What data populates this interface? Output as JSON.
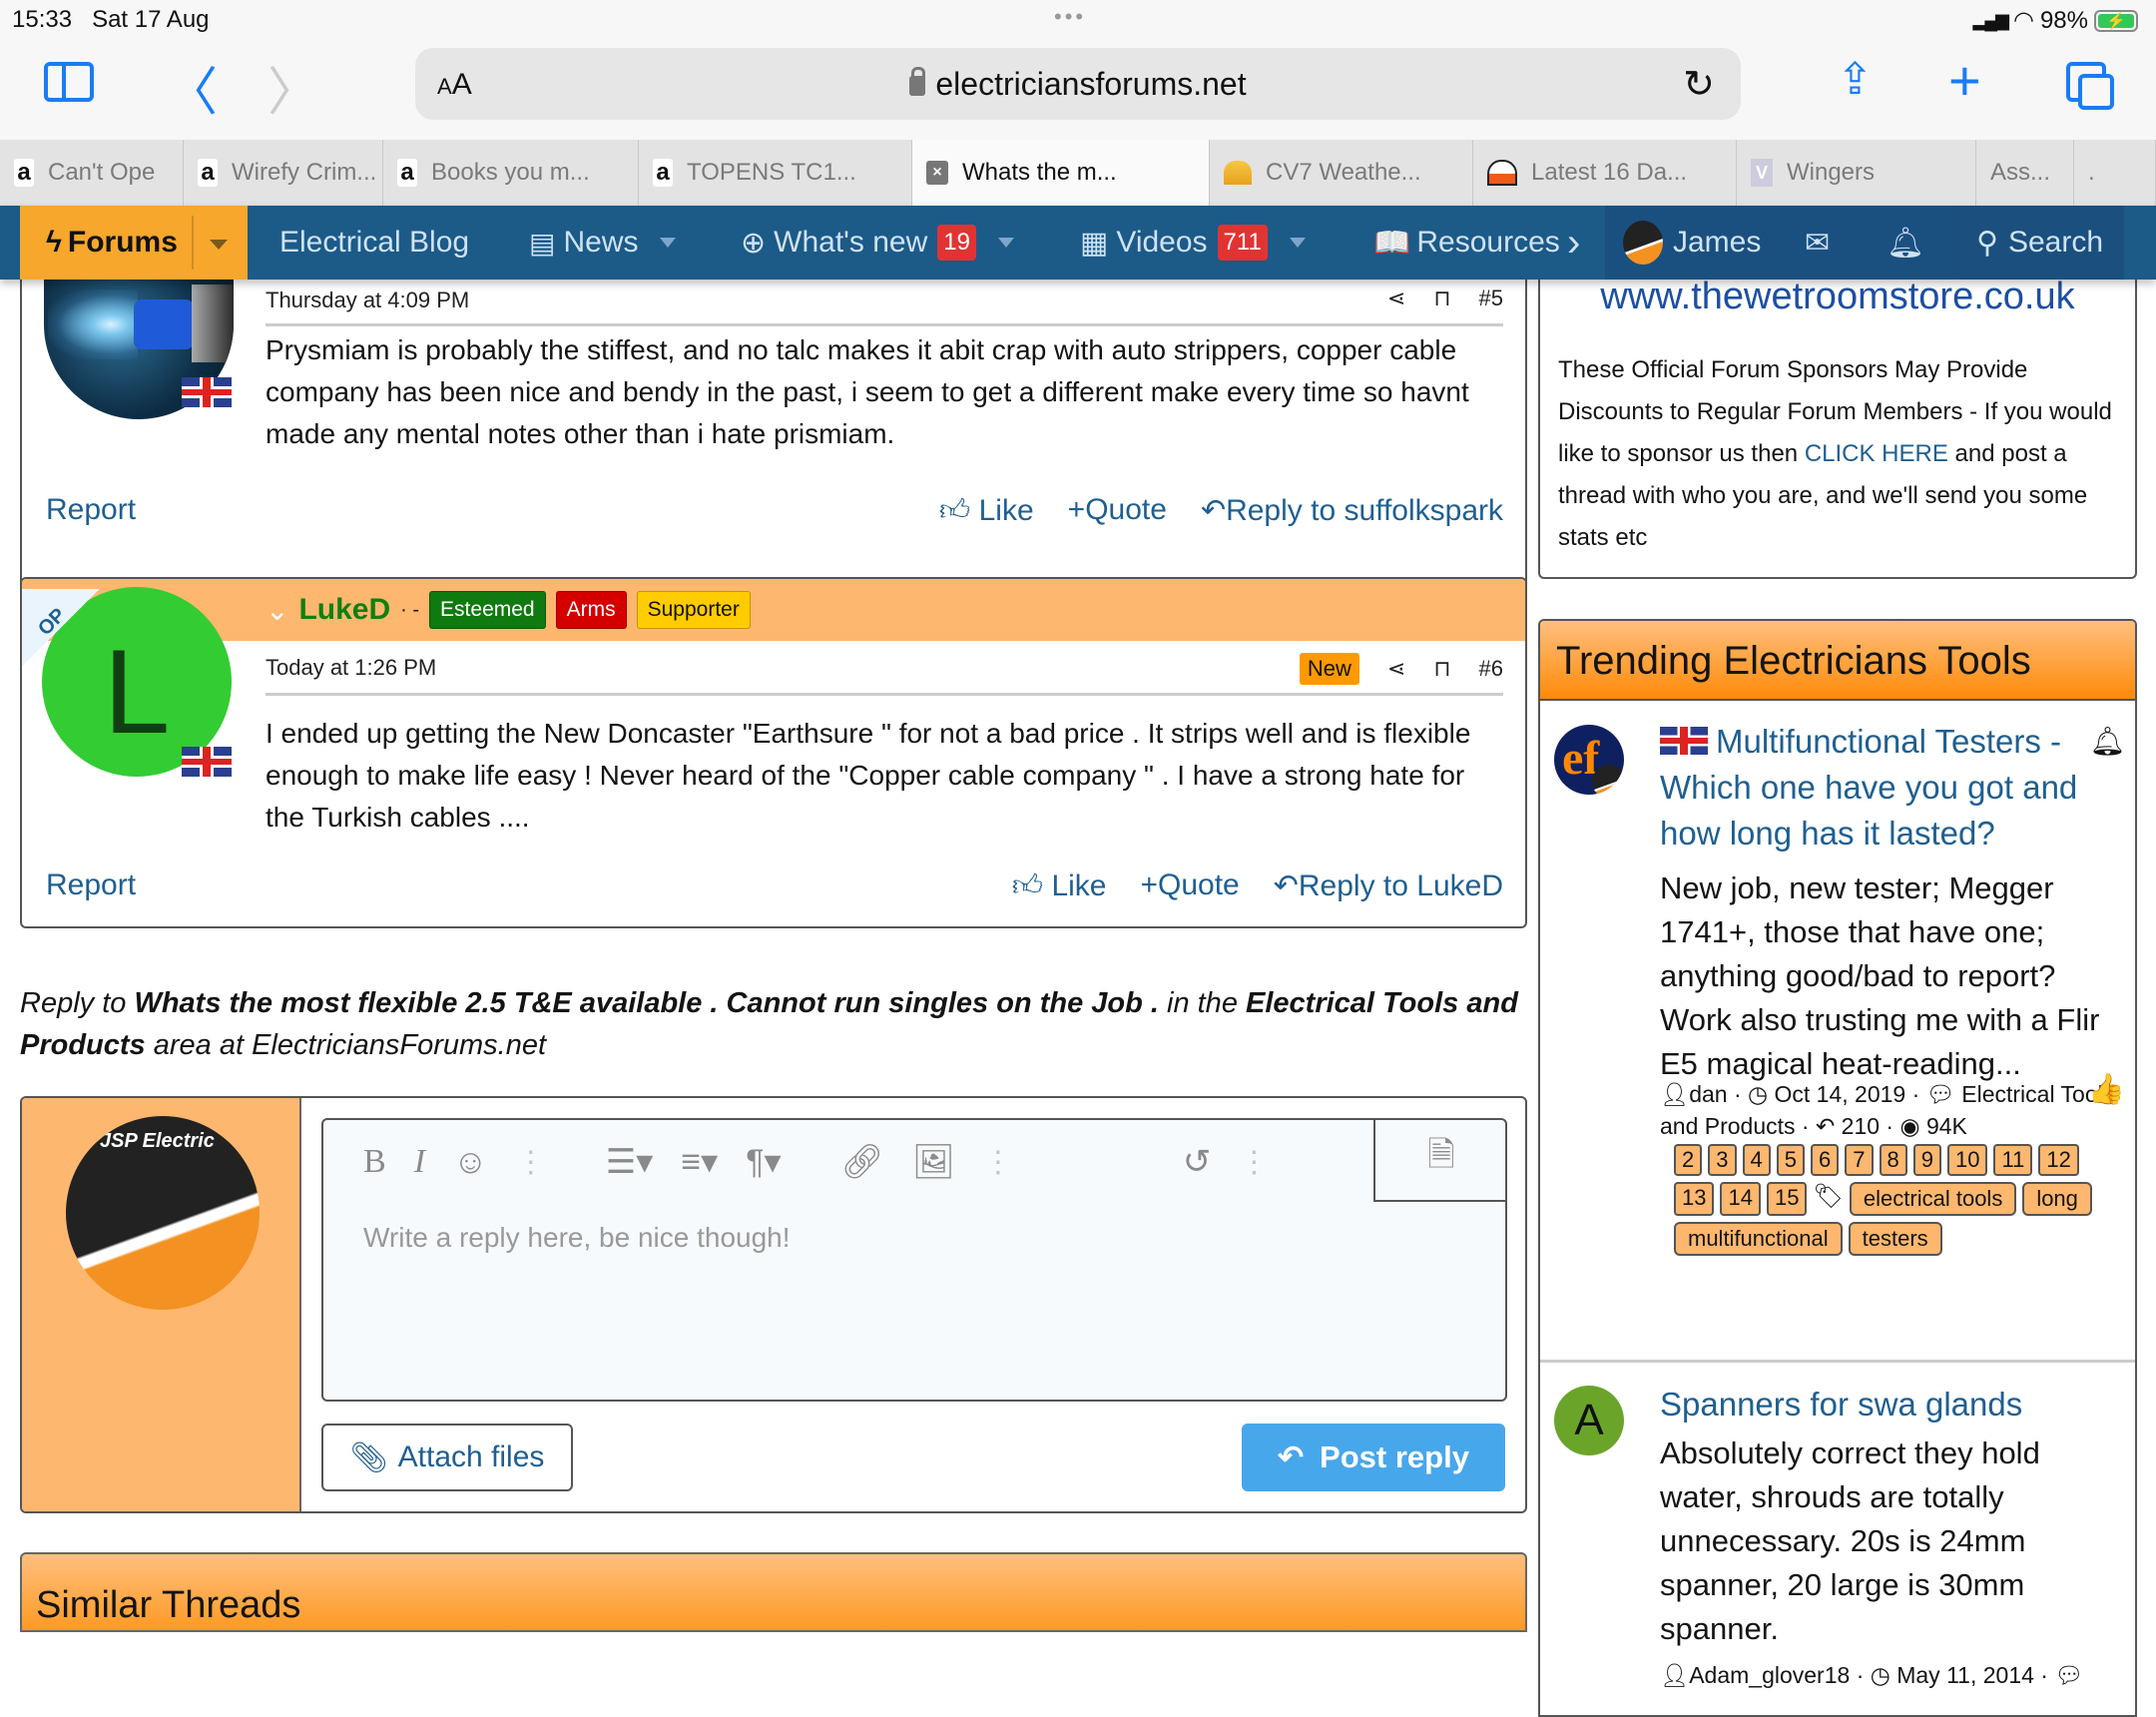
{
  "status_bar": {
    "time": "15:33",
    "date": "Sat 17 Aug",
    "battery": "98%"
  },
  "browser": {
    "text_size_label": "AA",
    "url": "electriciansforums.net",
    "tabs": [
      {
        "label": "Can't Ope",
        "favicon": "a"
      },
      {
        "label": "Wirefy Crim...",
        "favicon": "a"
      },
      {
        "label": "Books you m...",
        "favicon": "a"
      },
      {
        "label": "TOPENS TC1...",
        "favicon": "a"
      },
      {
        "label": "Whats the m...",
        "favicon": "×",
        "active": true
      },
      {
        "label": "CV7 Weathe...",
        "favicon": "sun"
      },
      {
        "label": "Latest 16 Da...",
        "favicon": "gauge"
      },
      {
        "label": "Wingers",
        "favicon": "V"
      },
      {
        "label": "Ass...",
        "favicon": ""
      },
      {
        "label": ".",
        "favicon": ""
      }
    ]
  },
  "nav": {
    "forums": "Forums",
    "blog": "Electrical Blog",
    "news": "News",
    "whats_new": "What's new",
    "whats_new_count": "19",
    "videos": "Videos",
    "videos_count": "711",
    "resources": "Resources",
    "user": "James",
    "search": "Search"
  },
  "posts": [
    {
      "date": "Thursday at 4:09 PM",
      "number": "#5",
      "body": "Prysmiam is probably the stiffest, and no talc makes it abit crap with auto strippers, copper cable company has been nice and bendy in the past, i seem to get a different make every time so havnt made any mental notes other than i hate prismiam.",
      "report": "Report",
      "like": "Like",
      "quote": "Quote",
      "reply": "Reply to suffolkspark"
    },
    {
      "username": "LukeD",
      "user_suffix": "· -",
      "avatar_letter": "L",
      "op_label": "OP",
      "badges": [
        {
          "label": "Esteemed",
          "color": "#0f7a0f",
          "text_color": "#ffffff"
        },
        {
          "label": "Arms",
          "color": "#d40000",
          "text_color": "#ffffff"
        },
        {
          "label": "Supporter",
          "color": "#ffcc00",
          "text_color": "#111111"
        }
      ],
      "date": "Today at 1:26 PM",
      "new_label": "New",
      "number": "#6",
      "body": "I ended up getting the New Doncaster \"Earthsure \" for not a bad price . It strips well and is flexible enough to make life easy ! Never heard of the \"Copper cable company \" . I have a strong hate for the Turkish cables ....",
      "report": "Report",
      "like": "Like",
      "quote": "Quote",
      "reply": "Reply to LukeD"
    }
  ],
  "reply_context": {
    "prefix": "Reply to",
    "thread": "Whats the most flexible 2.5 T&E available . Cannot run singles on the Job .",
    "middle": "in the",
    "forum": "Electrical Tools and Products",
    "suffix": "area at ElectriciansForums.net"
  },
  "editor": {
    "avatar_text": "JSP Electric",
    "placeholder": "Write a reply here, be nice though!",
    "attach": "Attach files",
    "post": "Post reply"
  },
  "similar_threads": {
    "title": "Similar Threads"
  },
  "sidebar": {
    "sponsor_ad": "www.thewetroomstore.co.uk",
    "sponsor_text_before": "These Official Forum Sponsors May Provide Discounts to Regular Forum Members - If you would like to sponsor us then",
    "sponsor_link": "CLICK HERE",
    "sponsor_text_after": "and post a thread with who you are, and we'll send you some stats etc",
    "trending_title": "Trending Electricians Tools",
    "items": [
      {
        "title": "Multifunctional Testers - Which one have you got and how long has it lasted?",
        "body": "New job, new tester; Megger 1741+, those that have one; anything good/bad to report? Work also trusting me with a Flir E5 magical heat-reading...",
        "author": "dan",
        "date": "Oct 14, 2019",
        "forum": "Electrical Tools and Products",
        "replies": "210",
        "views": "94K",
        "pages": [
          "2",
          "3",
          "4",
          "5",
          "6",
          "7",
          "8",
          "9",
          "10",
          "11",
          "12",
          "13",
          "14",
          "15"
        ],
        "tags": [
          "electrical tools",
          "long",
          "multifunctional",
          "testers"
        ]
      },
      {
        "avatar_letter": "A",
        "title": "Spanners for swa glands",
        "body": "Absolutely correct they hold water, shrouds are totally unnecessary. 20s is 24mm spanner, 20 large is 30mm spanner.",
        "author": "Adam_glover18",
        "date": "May 11, 2014"
      }
    ]
  },
  "colors": {
    "nav_bg": "#1c5a88",
    "accent_orange": "#f6a72c",
    "link_blue": "#1f5f91",
    "post_header": "#fdb76f",
    "post_button": "#47a7eb"
  }
}
